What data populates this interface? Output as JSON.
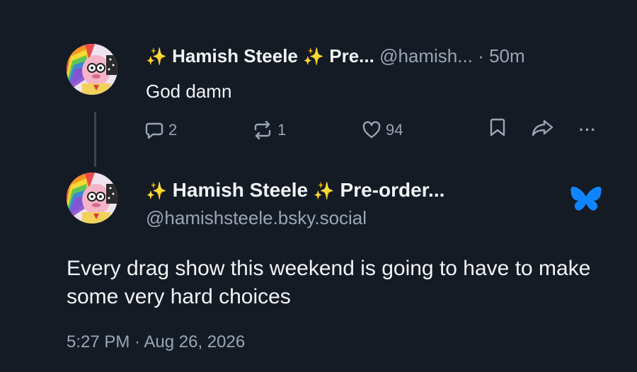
{
  "reply": {
    "display_name": "Hamish Steele",
    "name_suffix": "Pre...",
    "handle": "@hamish...",
    "separator": "·",
    "time_ago": "50m",
    "text": "God damn",
    "actions": {
      "reply_count": "2",
      "repost_count": "1",
      "like_count": "94",
      "more_label": "···"
    }
  },
  "post": {
    "display_name": "Hamish Steele",
    "name_suffix": "Pre-order...",
    "handle": "@hamishsteele.bsky.social",
    "text": "Every drag show this weekend is going to have to make some very hard choices",
    "timestamp": "5:27 PM · Aug 26, 2026"
  },
  "sparkle_glyph": "✨",
  "icons": {
    "reply": "speech-bubble-icon",
    "repost": "repost-icon",
    "like": "heart-icon",
    "bookmark": "bookmark-icon",
    "share": "share-icon",
    "more": "more-icon",
    "verified": "butterfly-icon"
  },
  "colors": {
    "background": "#151b24",
    "text": "#f1f3f5",
    "muted": "#9aa5b4",
    "brand_blue": "#1185fe",
    "sparkle": "#f4c542"
  }
}
